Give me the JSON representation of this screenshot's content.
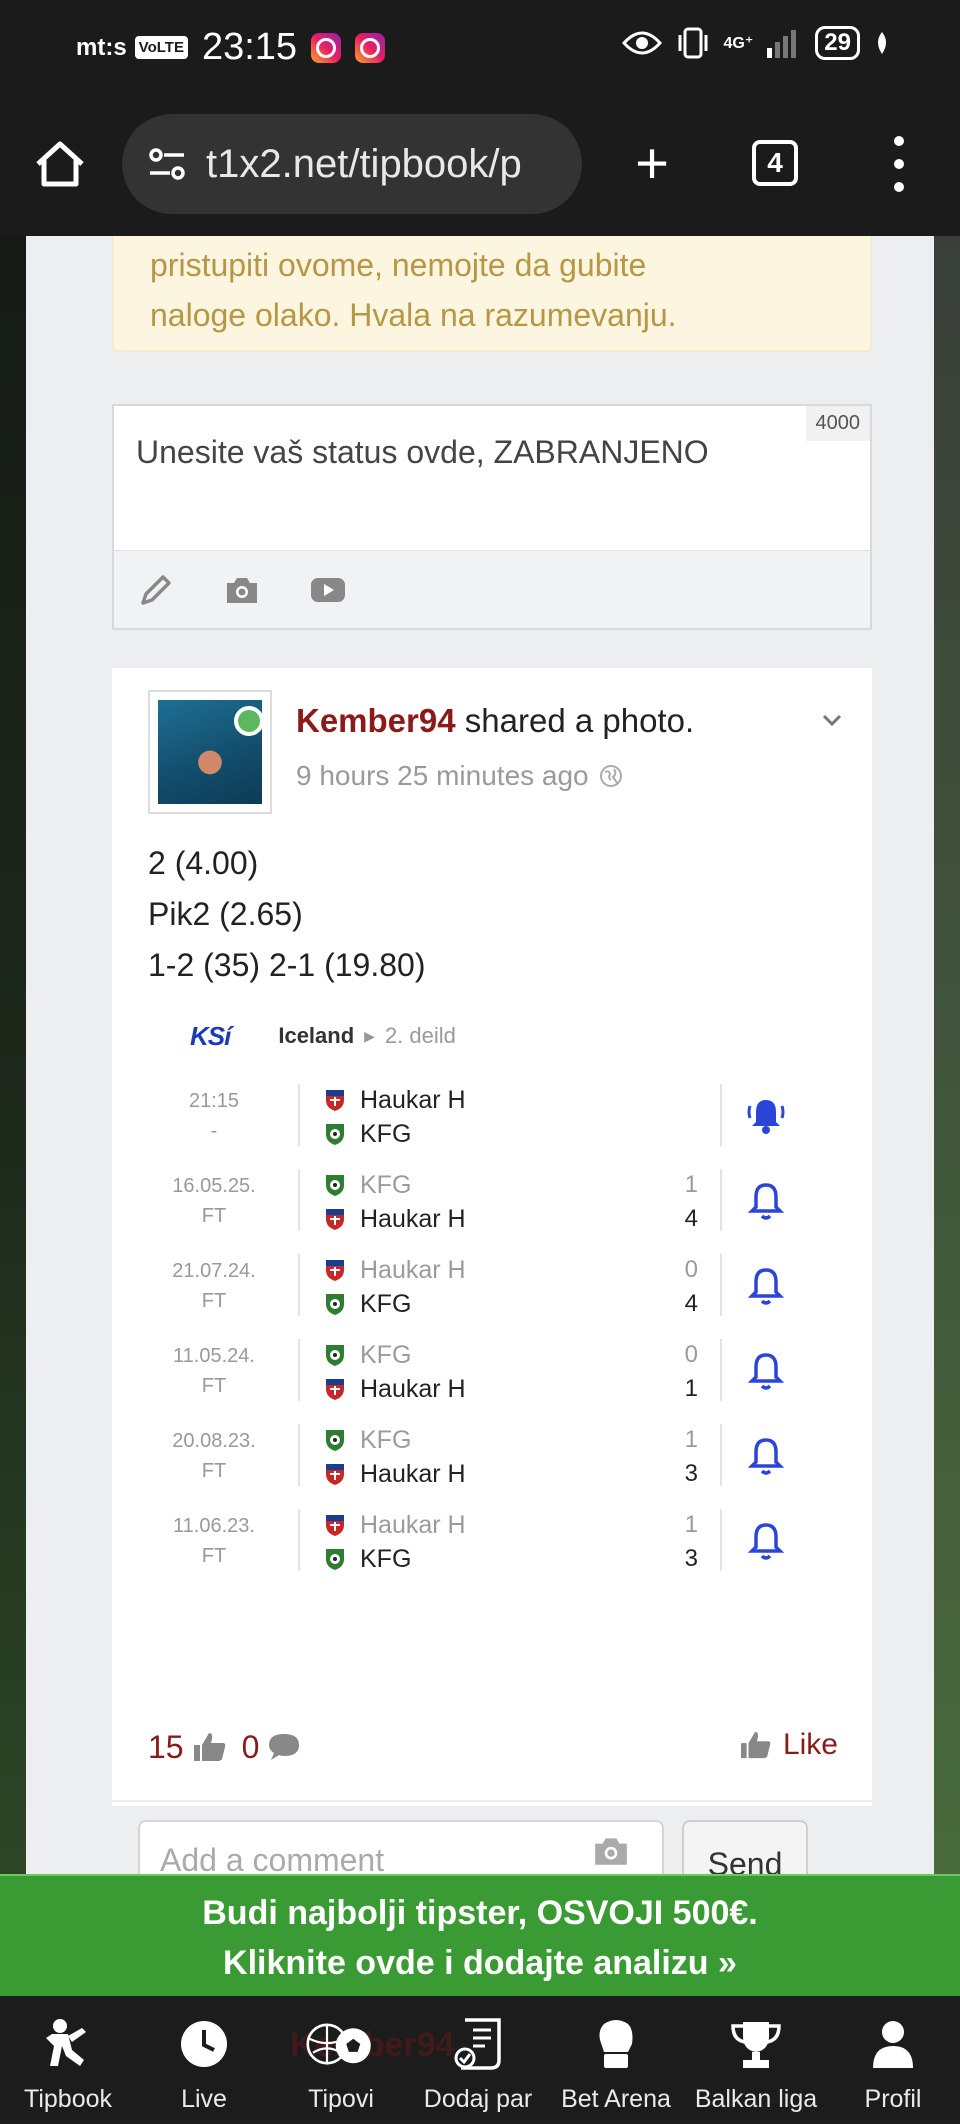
{
  "status_bar": {
    "carrier": "mt:s",
    "volte": "VoLTE",
    "time": "23:15",
    "network": "4G⁺",
    "battery": "29"
  },
  "browser": {
    "url": "t1x2.net/tipbook/p",
    "tab_count": "4"
  },
  "notice": {
    "lines": [
      "pristupiti ovome, nemojte da gubite",
      "naloge olako. Hvala na razumevanju."
    ]
  },
  "status_composer": {
    "placeholder": "Unesite vaš status ovde, ZABRANJENO",
    "char_limit": "4000"
  },
  "post": {
    "author": "Kember94",
    "action": "shared a photo.",
    "time": "9 hours 25 minutes ago",
    "lines": [
      "2 (4.00)",
      "Pik2 (2.65)",
      "1-2 (35) 2-1 (19.80)"
    ],
    "likes": "15",
    "comments": "0",
    "like_label": "Like"
  },
  "match_widget": {
    "logo_text": "KSí",
    "country": "Iceland",
    "league": "2. deild",
    "matches": [
      {
        "date": "21:15",
        "status": "-",
        "home": "Haukar H",
        "away": "KFG",
        "home_score": "",
        "away_score": "",
        "home_dim": false,
        "away_dim": false,
        "home_crest": "haukar",
        "away_crest": "kfg",
        "bell": "active"
      },
      {
        "date": "16.05.25.",
        "status": "FT",
        "home": "KFG",
        "away": "Haukar H",
        "home_score": "1",
        "away_score": "4",
        "home_dim": true,
        "away_dim": false,
        "home_crest": "kfg",
        "away_crest": "haukar",
        "bell": "outline"
      },
      {
        "date": "21.07.24.",
        "status": "FT",
        "home": "Haukar H",
        "away": "KFG",
        "home_score": "0",
        "away_score": "4",
        "home_dim": true,
        "away_dim": false,
        "home_crest": "haukar",
        "away_crest": "kfg",
        "bell": "outline"
      },
      {
        "date": "11.05.24.",
        "status": "FT",
        "home": "KFG",
        "away": "Haukar H",
        "home_score": "0",
        "away_score": "1",
        "home_dim": true,
        "away_dim": false,
        "home_crest": "kfg",
        "away_crest": "haukar",
        "bell": "outline"
      },
      {
        "date": "20.08.23.",
        "status": "FT",
        "home": "KFG",
        "away": "Haukar H",
        "home_score": "1",
        "away_score": "3",
        "home_dim": true,
        "away_dim": false,
        "home_crest": "kfg",
        "away_crest": "haukar",
        "bell": "outline"
      },
      {
        "date": "11.06.23.",
        "status": "FT",
        "home": "Haukar H",
        "away": "KFG",
        "home_score": "1",
        "away_score": "3",
        "home_dim": true,
        "away_dim": false,
        "home_crest": "haukar",
        "away_crest": "kfg",
        "bell": "outline"
      }
    ]
  },
  "comment_box": {
    "placeholder": "Add a comment",
    "send_label": "Send"
  },
  "promo_banner": {
    "line1": "Budi najbolji tipster, OSVOJI 500€.",
    "line2": "Kliknite ovde i dodajte analizu »"
  },
  "bottom_nav": {
    "ghost_author": "Kember94",
    "items": [
      {
        "label": "Tipbook",
        "icon": "player-icon"
      },
      {
        "label": "Live",
        "icon": "clock-icon"
      },
      {
        "label": "Tipovi",
        "icon": "balls-icon"
      },
      {
        "label": "Dodaj par",
        "icon": "ticket-icon"
      },
      {
        "label": "Bet Arena",
        "icon": "glove-icon"
      },
      {
        "label": "Balkan liga",
        "icon": "trophy-icon"
      },
      {
        "label": "Profil",
        "icon": "user-icon"
      }
    ]
  },
  "colors": {
    "author_red": "#8b1a1a",
    "bell_blue": "#2b45d8",
    "banner_green": "#3a9a34",
    "notice_text": "#b79645"
  }
}
